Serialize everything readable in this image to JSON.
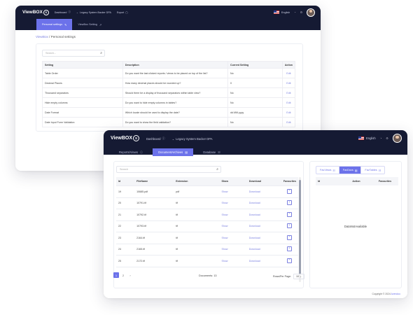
{
  "window1": {
    "logo_text": "ViewBOX",
    "logo_mark": "S",
    "nav": [
      {
        "label": "Dashboard",
        "icon": "info-icon"
      },
      {
        "label": "Legacy System Backer DPA",
        "icon": "chevron-down-icon"
      },
      {
        "label": "Export",
        "icon": "square-icon"
      }
    ],
    "language": "English",
    "subtabs": [
      {
        "label": "Personal settings",
        "icon": "edit-icon",
        "active": true
      },
      {
        "label": "ViewBox Setting",
        "icon": "external-link-icon",
        "active": false
      }
    ],
    "breadcrumb": {
      "root": "ViewBox",
      "separator": " / ",
      "current": "Personal settings"
    },
    "search_placeholder": "Search...",
    "table": {
      "headers": [
        "Setting",
        "Description",
        "Current Setting",
        "Action"
      ],
      "rows": [
        [
          "Table Order",
          "Do you want the last clicked reports / views to be placed on top of the list?",
          "No",
          "Edit"
        ],
        [
          "Decimal Places",
          "How many decimal places should be rounded up?",
          "0",
          "Edit"
        ],
        [
          "Thousand separators",
          "Should there be a display of thousand separators within table view?",
          "No",
          "Edit"
        ],
        [
          "Hide empty columns",
          "Do you want to hide empty columns in tables?",
          "No",
          "Edit"
        ],
        [
          "Date Format",
          "Which locale should be used to display the date?",
          "dd.MM.yyyy",
          "Edit"
        ],
        [
          "Date Input Form Validation",
          "Do you want to show the field validation?",
          "No",
          "Edit"
        ]
      ]
    }
  },
  "window2": {
    "logo_text": "ViewBOX",
    "logo_mark": "S",
    "nav": [
      {
        "label": "Dashboard",
        "icon": "info-icon"
      },
      {
        "label": "Legacy System Backer DPA",
        "icon": "chevron-down-icon"
      }
    ],
    "language": "English",
    "subtabs": [
      {
        "label": "Reports/Views",
        "icon": "info-icon",
        "active": false
      },
      {
        "label": "DocumentArchives",
        "icon": "archive-icon",
        "active": true
      },
      {
        "label": "Database",
        "icon": "table-icon",
        "active": false
      }
    ],
    "search_placeholder": "Search",
    "table": {
      "headers": [
        "Id",
        "FileName",
        "Extension",
        "Show",
        "Download",
        "Favourites"
      ],
      "rows": [
        [
          "19",
          "10685.pdf",
          "pdf",
          "Show",
          "Download"
        ],
        [
          "20",
          "10791.tif",
          "tif",
          "Show",
          "Download"
        ],
        [
          "21",
          "10792.tif",
          "tif",
          "Show",
          "Download"
        ],
        [
          "22",
          "10793.tif",
          "tif",
          "Show",
          "Download"
        ],
        [
          "23",
          "2164.tif",
          "tif",
          "Show",
          "Download"
        ],
        [
          "24",
          "2165.tif",
          "tif",
          "Show",
          "Download"
        ],
        [
          "25",
          "2172.tif",
          "tif",
          "Show",
          "Download"
        ]
      ]
    },
    "pagination": [
      "1",
      "2",
      "›"
    ],
    "documents_label": "Documents: 13",
    "rows_per_page_label": "Rows/Per Page:",
    "rows_per_page_value": "10",
    "fav_tabs": [
      {
        "label": "FavViews",
        "icon": "table-icon",
        "active": false
      },
      {
        "label": "FavDocs",
        "icon": "archive-icon",
        "active": true
      },
      {
        "label": "FavTables",
        "icon": "table-icon",
        "active": false
      }
    ],
    "fav_table_headers": [
      "Id",
      "Action",
      "Favourites"
    ],
    "no_data": "DataNotAvailable",
    "footer_prefix": "Copyright © 2024 ",
    "footer_brand": "Avendoo",
    "accent": "#6c72ea",
    "nav_bg": "#151a33"
  }
}
